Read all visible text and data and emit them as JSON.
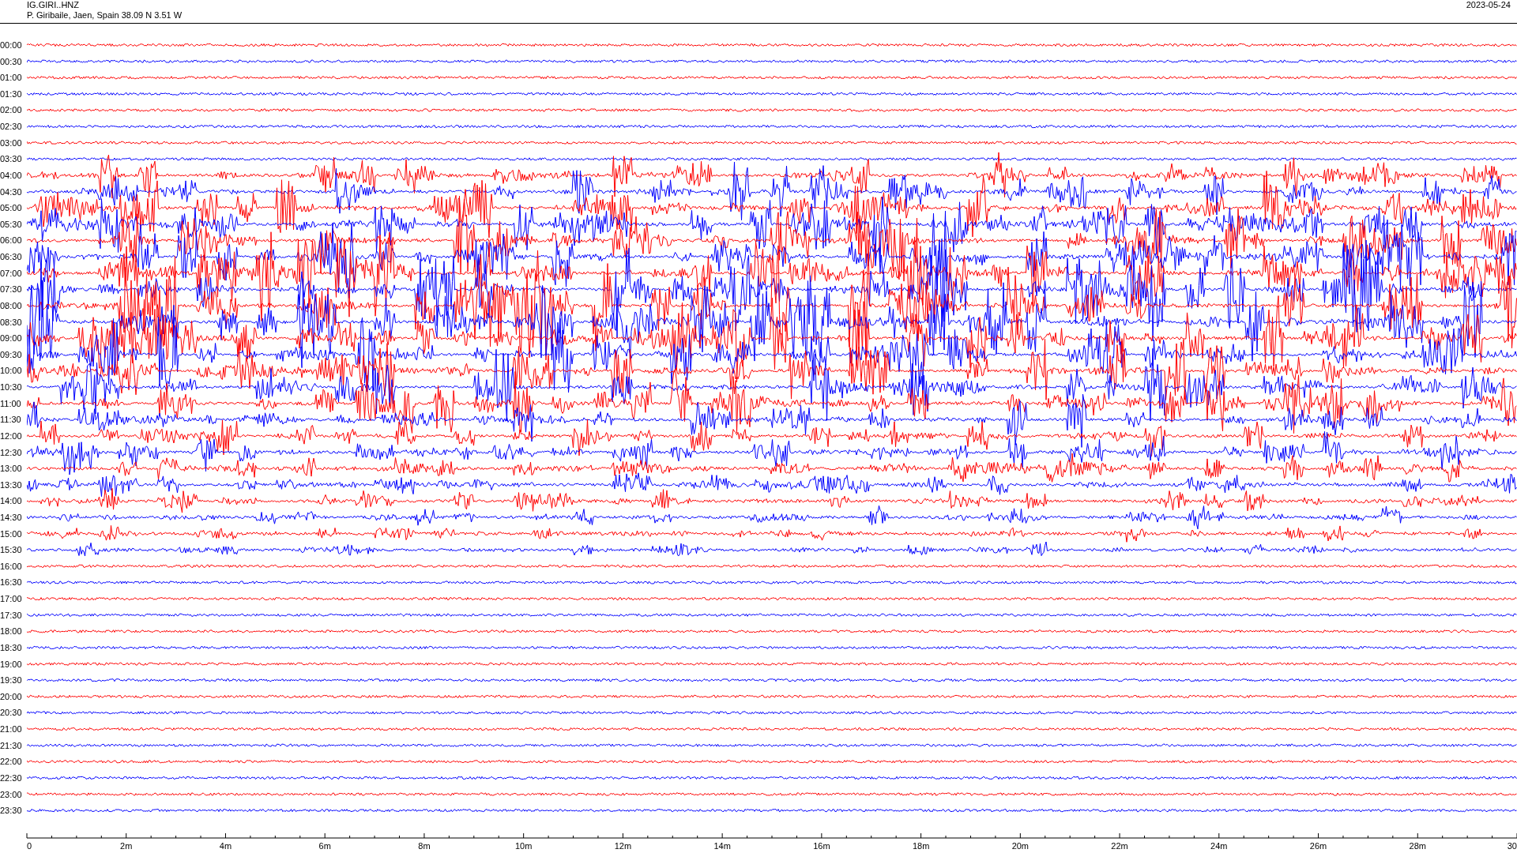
{
  "header": {
    "station": "IG.GIRI..HNZ",
    "location": "P. Giribaile, Jaen, Spain  38.09 N 3.51 W",
    "date": "2023-05-24"
  },
  "rows": [
    {
      "time": "00:00",
      "color": "#ff0000"
    },
    {
      "time": "00:30",
      "color": "#0000ff"
    },
    {
      "time": "01:00",
      "color": "#ff0000"
    },
    {
      "time": "01:30",
      "color": "#0000ff"
    },
    {
      "time": "02:00",
      "color": "#ff0000"
    },
    {
      "time": "02:30",
      "color": "#0000ff"
    },
    {
      "time": "03:00",
      "color": "#ff0000"
    },
    {
      "time": "03:30",
      "color": "#0000ff"
    },
    {
      "time": "04:00",
      "color": "#ff0000"
    },
    {
      "time": "04:30",
      "color": "#0000ff"
    },
    {
      "time": "05:00",
      "color": "#ff0000"
    },
    {
      "time": "05:30",
      "color": "#0000ff"
    },
    {
      "time": "06:00",
      "color": "#ff0000"
    },
    {
      "time": "06:30",
      "color": "#0000ff"
    },
    {
      "time": "07:00",
      "color": "#ff0000"
    },
    {
      "time": "07:30",
      "color": "#0000ff"
    },
    {
      "time": "08:00",
      "color": "#ff0000"
    },
    {
      "time": "08:30",
      "color": "#0000ff"
    },
    {
      "time": "09:00",
      "color": "#ff0000"
    },
    {
      "time": "09:30",
      "color": "#0000ff"
    },
    {
      "time": "10:00",
      "color": "#ff0000"
    },
    {
      "time": "10:30",
      "color": "#0000ff"
    },
    {
      "time": "11:00",
      "color": "#ff0000"
    },
    {
      "time": "11:30",
      "color": "#0000ff"
    },
    {
      "time": "12:00",
      "color": "#ff0000"
    },
    {
      "time": "12:30",
      "color": "#0000ff"
    },
    {
      "time": "13:00",
      "color": "#ff0000"
    },
    {
      "time": "13:30",
      "color": "#0000ff"
    },
    {
      "time": "14:00",
      "color": "#ff0000"
    },
    {
      "time": "14:30",
      "color": "#0000ff"
    },
    {
      "time": "15:00",
      "color": "#ff0000"
    },
    {
      "time": "15:30",
      "color": "#0000ff"
    },
    {
      "time": "16:00",
      "color": "#ff0000"
    },
    {
      "time": "16:30",
      "color": "#0000ff"
    },
    {
      "time": "17:00",
      "color": "#ff0000"
    },
    {
      "time": "17:30",
      "color": "#0000ff"
    },
    {
      "time": "18:00",
      "color": "#ff0000"
    },
    {
      "time": "18:30",
      "color": "#0000ff"
    },
    {
      "time": "19:00",
      "color": "#ff0000"
    },
    {
      "time": "19:30",
      "color": "#0000ff"
    },
    {
      "time": "20:00",
      "color": "#ff0000"
    },
    {
      "time": "20:30",
      "color": "#0000ff"
    },
    {
      "time": "21:00",
      "color": "#ff0000"
    },
    {
      "time": "21:30",
      "color": "#0000ff"
    },
    {
      "time": "22:00",
      "color": "#ff0000"
    },
    {
      "time": "22:30",
      "color": "#0000ff"
    },
    {
      "time": "23:00",
      "color": "#ff0000"
    },
    {
      "time": "23:30",
      "color": "#0000ff"
    }
  ],
  "axis_ticks": [
    "0",
    "2m",
    "4m",
    "6m",
    "8m",
    "10m",
    "12m",
    "14m",
    "16m",
    "18m",
    "20m",
    "22m",
    "24m",
    "26m",
    "28m",
    "30"
  ]
}
